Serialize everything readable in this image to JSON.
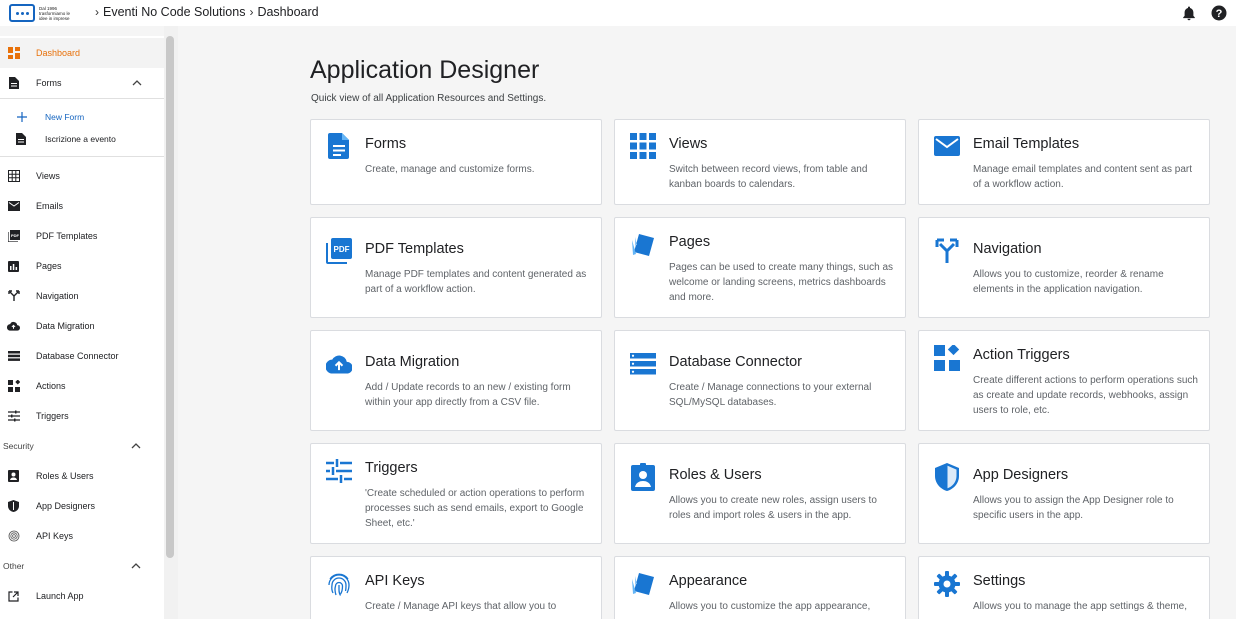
{
  "header": {
    "logo_text": "Dal 1996 trasformiamo le idee in imprese",
    "breadcrumb": [
      "Eventi No Code Solutions",
      "Dashboard"
    ]
  },
  "sidebar": {
    "dashboard": "Dashboard",
    "forms": "Forms",
    "new_form": "New Form",
    "form_item": "Iscrizione a evento",
    "views": "Views",
    "emails": "Emails",
    "pdf_templates": "PDF Templates",
    "pages": "Pages",
    "navigation": "Navigation",
    "data_migration": "Data Migration",
    "database_connector": "Database Connector",
    "actions": "Actions",
    "triggers": "Triggers",
    "security": "Security",
    "roles_users": "Roles & Users",
    "app_designers": "App Designers",
    "api_keys": "API Keys",
    "other": "Other",
    "launch_app": "Launch App"
  },
  "main": {
    "title": "Application Designer",
    "subtitle": "Quick view of all Application Resources and Settings.",
    "cards": [
      {
        "title": "Forms",
        "desc": "Create, manage and customize forms.",
        "icon": "form-icon"
      },
      {
        "title": "Views",
        "desc": "Switch between record views, from table and kanban boards to calendars.",
        "icon": "grid-icon"
      },
      {
        "title": "Email Templates",
        "desc": "Manage email templates and content sent as part of a workflow action.",
        "icon": "email-icon"
      },
      {
        "title": "PDF Templates",
        "desc": "Manage PDF templates and content generated as part of a workflow action.",
        "icon": "pdf-icon"
      },
      {
        "title": "Pages",
        "desc": "Pages can be used to create many things, such as welcome or landing screens, metrics dashboards and more.",
        "icon": "pages-icon"
      },
      {
        "title": "Navigation",
        "desc": "Allows you to customize, reorder & rename elements in the application navigation.",
        "icon": "navigation-icon"
      },
      {
        "title": "Data Migration",
        "desc": "Add / Update records to an new / existing form within your app directly from a CSV file.",
        "icon": "cloud-upload-icon"
      },
      {
        "title": "Database Connector",
        "desc": "Create / Manage connections to your external SQL/MySQL databases.",
        "icon": "database-icon"
      },
      {
        "title": "Action Triggers",
        "desc": "Create different actions to perform operations such as create and update records, webhooks, assign users to role, etc.",
        "icon": "widgets-icon"
      },
      {
        "title": "Triggers",
        "desc": "'Create scheduled or action operations to perform processes such as send emails, export to Google Sheet, etc.'",
        "icon": "tune-icon"
      },
      {
        "title": "Roles & Users",
        "desc": "Allows you to create new roles, assign users to roles and import roles & users in the app.",
        "icon": "user-badge-icon"
      },
      {
        "title": "App Designers",
        "desc": "Allows you to assign the App Designer role to specific users in the app.",
        "icon": "shield-icon"
      },
      {
        "title": "API Keys",
        "desc": "Create / Manage API keys that allow you to",
        "icon": "fingerprint-icon"
      },
      {
        "title": "Appearance",
        "desc": "Allows you to customize the app appearance,",
        "icon": "appearance-icon"
      },
      {
        "title": "Settings",
        "desc": "Allows you to manage the app settings & theme,",
        "icon": "gear-icon"
      }
    ]
  },
  "colors": {
    "accent": "#e8710a",
    "icon_blue": "#1976d2",
    "link_blue": "#1565c0"
  }
}
